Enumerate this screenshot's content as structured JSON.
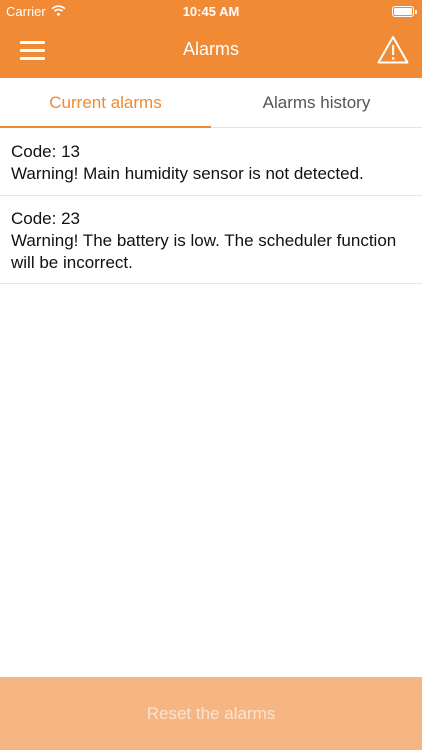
{
  "status_bar": {
    "carrier": "Carrier",
    "time": "10:45 AM",
    "battery_level": 1.0
  },
  "nav": {
    "title": "Alarms",
    "menu_icon": "hamburger-icon",
    "action_icon": "warning-triangle-icon"
  },
  "tabs": [
    {
      "label": "Current alarms",
      "active": true
    },
    {
      "label": "Alarms history",
      "active": false
    }
  ],
  "alarms": [
    {
      "code": "Code: 13",
      "message": "Warning! Main humidity sensor is not detected."
    },
    {
      "code": "Code: 23",
      "message": "Warning! The battery is low. The scheduler function will be incorrect."
    }
  ],
  "footer": {
    "reset_label": "Reset the alarms"
  },
  "colors": {
    "accent": "#f08a35",
    "footer_bg": "#f5b683",
    "footer_text": "#fde3cc"
  }
}
